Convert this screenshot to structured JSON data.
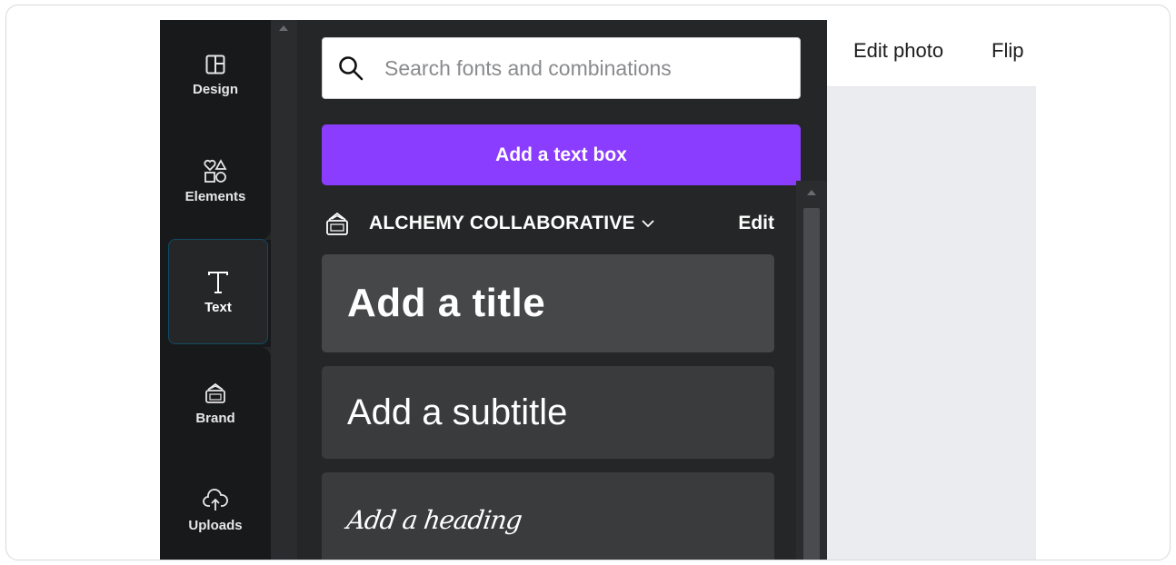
{
  "rail": {
    "items": [
      {
        "label": "Design",
        "icon": "layout-icon"
      },
      {
        "label": "Elements",
        "icon": "shapes-icon"
      },
      {
        "label": "Text",
        "icon": "text-icon",
        "active": true
      },
      {
        "label": "Brand",
        "icon": "brand-kit-icon"
      },
      {
        "label": "Uploads",
        "icon": "cloud-upload-icon"
      }
    ]
  },
  "panel": {
    "search": {
      "placeholder": "Search fonts and combinations",
      "value": ""
    },
    "add_text_box": "Add a text box",
    "brand": {
      "name": "ALCHEMY COLLABORATIVE",
      "edit": "Edit"
    },
    "presets": {
      "title": "Add a title",
      "subtitle": "Add a subtitle",
      "heading": "Add a heading"
    }
  },
  "toolbar": {
    "edit_photo": "Edit photo",
    "flip": "Flip"
  },
  "colors": {
    "accent": "#8b3dff",
    "rail_bg": "#18191b",
    "panel_bg": "#252627",
    "card_bg": "#3a3b3d",
    "canvas_bg": "#ebecf0"
  }
}
